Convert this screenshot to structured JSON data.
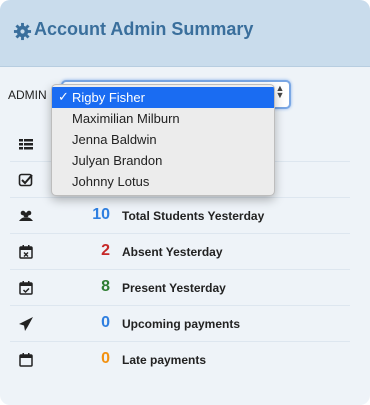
{
  "header": {
    "title": "Account Admin Summary",
    "icon": "gear-icon"
  },
  "admin": {
    "label": "ADMIN",
    "selected": "Rigby Fisher",
    "options": [
      "Rigby Fisher",
      "Maximilian Milburn",
      "Jenna Baldwin",
      "Julyan Brandon",
      "Johnny Lotus"
    ]
  },
  "stats": [
    {
      "icon": "list-icon",
      "value": "",
      "label": "",
      "color": "#222222"
    },
    {
      "icon": "checkbox-icon",
      "value": "",
      "label": "",
      "color": "#222222"
    },
    {
      "icon": "users-icon",
      "value": "10",
      "label": "Total Students Yesterday",
      "color": "#2f7fe0"
    },
    {
      "icon": "calendar-x-icon",
      "value": "2",
      "label": "Absent Yesterday",
      "color": "#c62828"
    },
    {
      "icon": "calendar-check-icon",
      "value": "8",
      "label": "Present Yesterday",
      "color": "#2e7d32"
    },
    {
      "icon": "send-icon",
      "value": "0",
      "label": "Upcoming payments",
      "color": "#2f7fe0"
    },
    {
      "icon": "calendar-icon",
      "value": "0",
      "label": "Late payments",
      "color": "#f29111"
    }
  ]
}
